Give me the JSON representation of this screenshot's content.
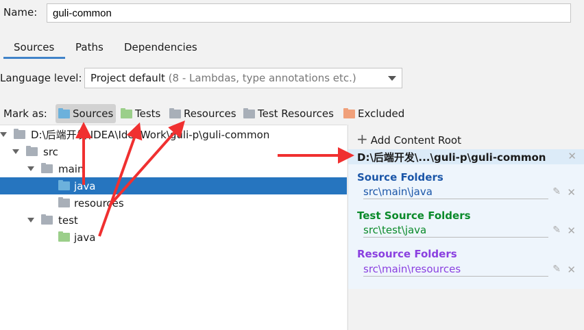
{
  "name": {
    "label": "Name:",
    "value": "guli-common"
  },
  "tabs": [
    "Sources",
    "Paths",
    "Dependencies"
  ],
  "language": {
    "label": "Language level:",
    "value": "Project default",
    "hint": "(8 - Lambdas, type annotations etc.)"
  },
  "mark_as": {
    "label": "Mark as:",
    "items": [
      "Sources",
      "Tests",
      "Resources",
      "Test Resources",
      "Excluded"
    ]
  },
  "tree": [
    {
      "label": "D:\\后端开发\\IDEA\\IdeaWork\\guli-p\\guli-common",
      "depth": 0
    },
    {
      "label": "src",
      "depth": 1
    },
    {
      "label": "main",
      "depth": 2
    },
    {
      "label": "java",
      "depth": 3
    },
    {
      "label": "resources",
      "depth": 3
    },
    {
      "label": "test",
      "depth": 2
    },
    {
      "label": "java",
      "depth": 3
    }
  ],
  "right": {
    "add_root": "Add Content Root",
    "root": "D:\\后端开发\\...\\guli-p\\guli-common",
    "source_title": "Source Folders",
    "source_path": "src\\main\\java",
    "test_title": "Test Source Folders",
    "test_path": "src\\test\\java",
    "res_title": "Resource Folders",
    "res_path": "src\\main\\resources"
  },
  "colors": {
    "source": "#1b56a8",
    "test": "#0a8a2a",
    "resource": "#8a3fe0",
    "selection": "#2675bf"
  }
}
